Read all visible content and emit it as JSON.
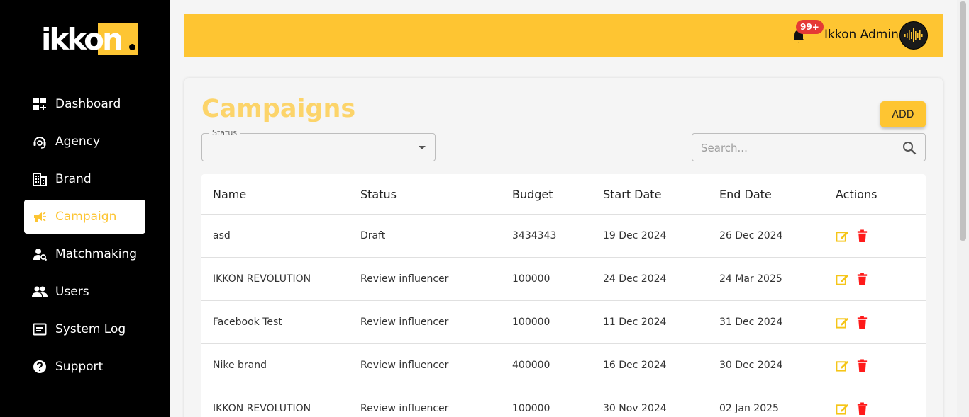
{
  "app": {
    "logo_text": "ikkon",
    "brand_accent": "#fec532"
  },
  "sidebar": {
    "items": [
      {
        "label": "Dashboard",
        "icon": "dashboard-icon",
        "active": false
      },
      {
        "label": "Agency",
        "icon": "support-agent-icon",
        "active": false
      },
      {
        "label": "Brand",
        "icon": "building-icon",
        "active": false
      },
      {
        "label": "Campaign",
        "icon": "megaphone-icon",
        "active": true
      },
      {
        "label": "Matchmaking",
        "icon": "person-search-icon",
        "active": false
      },
      {
        "label": "Users",
        "icon": "users-icon",
        "active": false
      },
      {
        "label": "System Log",
        "icon": "log-icon",
        "active": false
      },
      {
        "label": "Support",
        "icon": "help-icon",
        "active": false
      }
    ]
  },
  "header": {
    "notification_count": "99+",
    "user_name": "Ikkon Admin"
  },
  "main": {
    "title": "Campaigns",
    "add_label": "ADD",
    "status_filter_label": "Status",
    "status_filter_value": "",
    "search_placeholder": "Search..."
  },
  "table": {
    "columns": [
      "Name",
      "Status",
      "Budget",
      "Start Date",
      "End Date",
      "Actions"
    ],
    "rows": [
      {
        "name": "asd",
        "status": "Draft",
        "budget": "3434343",
        "start": "19 Dec 2024",
        "end": "26 Dec 2024"
      },
      {
        "name": "IKKON REVOLUTION",
        "status": "Review influencer",
        "budget": "100000",
        "start": "24 Dec 2024",
        "end": "24 Mar 2025"
      },
      {
        "name": "Facebook Test",
        "status": "Review influencer",
        "budget": "100000",
        "start": "11 Dec 2024",
        "end": "31 Dec 2024"
      },
      {
        "name": "Nike brand",
        "status": "Review influencer",
        "budget": "400000",
        "start": "16 Dec 2024",
        "end": "30 Dec 2024"
      },
      {
        "name": "IKKON REVOLUTION",
        "status": "Review influencer",
        "budget": "100000",
        "start": "30 Nov 2024",
        "end": "02 Jan 2025"
      }
    ]
  },
  "colors": {
    "edit_icon": "#f5c518",
    "delete_icon": "#ff1a1a",
    "title": "#fcd46a"
  }
}
